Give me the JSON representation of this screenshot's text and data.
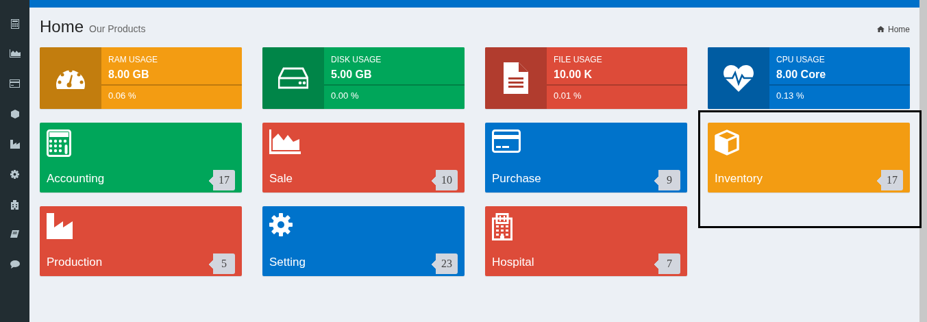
{
  "header": {
    "title": "Home",
    "subtitle": "Our Products"
  },
  "breadcrumb": [
    {
      "label": "Home"
    }
  ],
  "stats": [
    {
      "label": "RAM USAGE",
      "value": "8.00 GB",
      "percent": "0.06 %",
      "color": "#f39c12",
      "kind": "gauge"
    },
    {
      "label": "DISK USAGE",
      "value": "5.00 GB",
      "percent": "0.00 %",
      "color": "#00a65a",
      "kind": "disk"
    },
    {
      "label": "FILE USAGE",
      "value": "10.00 K",
      "percent": "0.01 %",
      "color": "#dd4b39",
      "kind": "file"
    },
    {
      "label": "CPU USAGE",
      "value": "8.00 Core",
      "percent": "0.13 %",
      "color": "#0073cb",
      "kind": "heart"
    }
  ],
  "tiles": [
    {
      "name": "Accounting",
      "count": "17",
      "color": "#00a65a",
      "kind": "calculator",
      "highlighted": false
    },
    {
      "name": "Sale",
      "count": "10",
      "color": "#dd4b39",
      "kind": "chart",
      "highlighted": false
    },
    {
      "name": "Purchase",
      "count": "9",
      "color": "#0073cb",
      "kind": "card",
      "highlighted": false
    },
    {
      "name": "Inventory",
      "count": "17",
      "color": "#f39c12",
      "kind": "cube",
      "highlighted": true
    },
    {
      "name": "Production",
      "count": "5",
      "color": "#dd4b39",
      "kind": "factory",
      "highlighted": false
    },
    {
      "name": "Setting",
      "count": "23",
      "color": "#0073cb",
      "kind": "gear",
      "highlighted": false
    },
    {
      "name": "Hospital",
      "count": "7",
      "color": "#dd4b39",
      "kind": "hospital",
      "highlighted": false
    }
  ]
}
